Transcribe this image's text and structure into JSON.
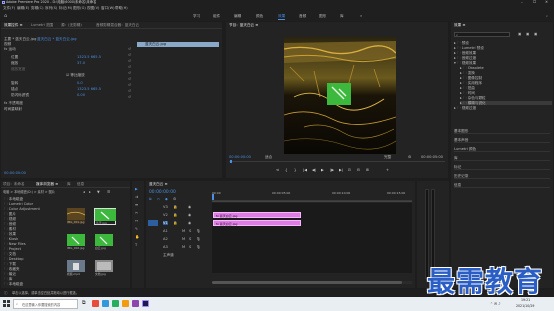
{
  "titlebar": {
    "title": "Adobe Premiere Pro 2020 - D:\\电脑\\6000\\未命名\\未命名",
    "controls": [
      "–",
      "☐",
      "✕"
    ]
  },
  "menubar": [
    "文件(F)",
    "编辑(E)",
    "剪辑(C)",
    "序列(S)",
    "标记(M)",
    "图形(G)",
    "视图(V)",
    "窗口(W)",
    "帮助(H)"
  ],
  "workspaces": [
    "学习",
    "组件",
    "编辑",
    "颜色",
    "效果",
    "音频",
    "图形",
    "库"
  ],
  "workspace_active": "效果",
  "effect_controls": {
    "tabs": [
      "效果控件 ≡",
      "Lumetri 范围",
      "源：(无剪辑)",
      "音频剪辑混合器：蓝天白云"
    ],
    "source_label": "主要 * 蓝天白云.jpg",
    "clip_label": "蓝天白云 * 蓝天白云.jpg",
    "clip_bar_label": "蓝天白云.jpg",
    "section_video": "视频",
    "rows": [
      {
        "name": "fx 运动",
        "value": ""
      },
      {
        "name": "位置",
        "value": "1323.5   665.5"
      },
      {
        "name": "缩放",
        "value": "37.0"
      },
      {
        "name": "缩放宽度",
        "value": ""
      },
      {
        "name": "",
        "value": "☑ 等比缩放"
      },
      {
        "name": "旋转",
        "value": "0.0"
      },
      {
        "name": "锚点",
        "value": "1323.5   665.5"
      },
      {
        "name": "防闪烁滤镜",
        "value": "0.00"
      },
      {
        "name": "fx 不透明度",
        "value": ""
      },
      {
        "name": "时间重映射",
        "value": ""
      }
    ],
    "timecode": "00:00:00:00"
  },
  "program": {
    "tab": "节目：蓝天白云 ≡",
    "timecode_left": "00:00:00:00",
    "fit": "适合",
    "quality": "完整",
    "timecode_right": "00:00:05:00",
    "buttons": [
      "⊲",
      "{",
      "}",
      "|◀",
      "◀|",
      "▶",
      "|▶",
      "▶|",
      "⊡",
      "⊟",
      "⊞",
      "+"
    ]
  },
  "effects": {
    "title": "效果 ≡",
    "search_placeholder": "",
    "tree": [
      {
        "label": "预设",
        "indent": 0,
        "icon": "folder"
      },
      {
        "label": "Lumetri 预设",
        "indent": 0,
        "icon": "folder"
      },
      {
        "label": "音频效果",
        "indent": 0,
        "icon": "folder"
      },
      {
        "label": "音频过渡",
        "indent": 0,
        "icon": "folder"
      },
      {
        "label": "视频效果",
        "indent": 0,
        "icon": "folder"
      },
      {
        "label": "Obsolete",
        "indent": 1,
        "icon": "folder"
      },
      {
        "label": "变换",
        "indent": 1,
        "icon": "folder"
      },
      {
        "label": "图像控制",
        "indent": 1,
        "icon": "folder"
      },
      {
        "label": "实用程序",
        "indent": 1,
        "icon": "folder"
      },
      {
        "label": "扭曲",
        "indent": 1,
        "icon": "folder"
      },
      {
        "label": "时间",
        "indent": 1,
        "icon": "folder"
      },
      {
        "label": "杂色与颗粒",
        "indent": 1,
        "icon": "folder"
      },
      {
        "label": "模糊与锐化",
        "indent": 1,
        "icon": "folder"
      },
      {
        "label": "视频过渡",
        "indent": 0,
        "icon": "folder"
      }
    ],
    "other_panels": [
      "基本图形",
      "基本声音",
      "Lumetri 颜色",
      "库",
      "标记",
      "历史记录",
      "信息"
    ]
  },
  "project": {
    "tabs": [
      "项目：未命名",
      "媒体浏览器 ≡",
      "库",
      "信息"
    ],
    "crumb": "电脑 > 本地磁盘(D:) > 素材 > 图片",
    "folders": [
      "本地磁盘",
      "Lumetri Color",
      "Color Adjustment",
      "图片",
      "视频",
      "音频",
      "素材",
      "效果",
      "Kiosk",
      "New Files",
      "Project",
      "文档",
      "Desktop",
      "下载",
      "收藏夹",
      "最近",
      "库",
      "本地磁盘"
    ],
    "thumbs": [
      {
        "label": "IMG_001.jpg",
        "dur": ""
      },
      {
        "label": "蓝天.jpg",
        "dur": ""
      },
      {
        "label": "IMG_002.jpg",
        "dur": ""
      },
      {
        "label": "白云.jpg",
        "dur": ""
      },
      {
        "label": "视频.mp4",
        "dur": "5:00"
      },
      {
        "label": "文档.jpg",
        "dur": ""
      },
      {
        "label": "",
        "dur": ""
      },
      {
        "label": "",
        "dur": ""
      }
    ]
  },
  "timeline": {
    "tab": "蓝天白云 ≡",
    "timecode": "00:00:00:00",
    "ruler_ticks": [
      "00:00",
      "00:00:05:00",
      "00:00:10:00",
      "00:00:15:00"
    ],
    "tracks": [
      {
        "id": "V3",
        "type": "video"
      },
      {
        "id": "V2",
        "type": "video"
      },
      {
        "id": "V1",
        "type": "video"
      },
      {
        "id": "A1",
        "type": "audio"
      },
      {
        "id": "A2",
        "type": "audio"
      },
      {
        "id": "A3",
        "type": "audio"
      }
    ],
    "clips": [
      {
        "track": "V2",
        "label": "fx 蓝天白云.jpg"
      },
      {
        "track": "V1",
        "label": "fx 蓝天白云.jpg"
      }
    ],
    "master": "主声道"
  },
  "status": {
    "text": "单击以选择，或单击空白处并拖动以进行框选。"
  },
  "taskbar": {
    "search": "在这里输入你要搜索的内容",
    "time": "19:21",
    "date": "2021/10/29"
  },
  "watermark": "最需教育",
  "colors": {
    "accent": "#2d8ceb",
    "clip": "#e07ce6",
    "bg": "#232323",
    "timecode": "#3b82f6"
  }
}
